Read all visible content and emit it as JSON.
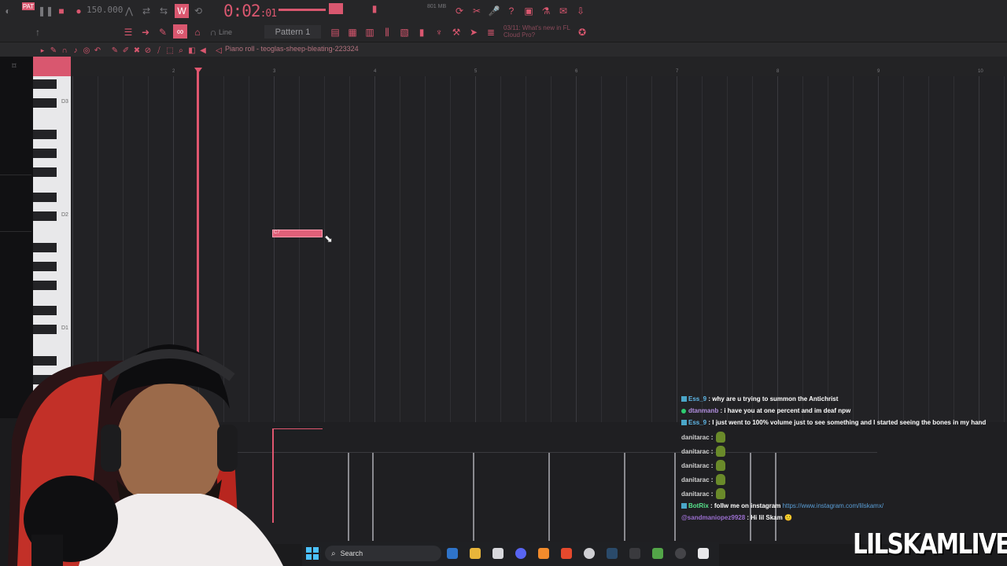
{
  "toolbar": {
    "tempo": "150.000",
    "time_main": "0:02",
    "time_sub": ":01",
    "ram": "801 MB",
    "news": "03/11: What's new in FL Cloud Pro?",
    "pattern": "Pattern 1",
    "snap_mode": "Line"
  },
  "piano_roll": {
    "title": "Piano roll - teoglas-sheep-bleating-223324",
    "key_labels": [
      "D3",
      "D2",
      "D1"
    ],
    "bar_numbers": [
      "2",
      "3",
      "4",
      "5",
      "6",
      "7",
      "8",
      "9",
      "10"
    ],
    "note_label": "C7"
  },
  "chat": [
    {
      "user": "Ess_9",
      "text": ": why are u trying to summon the Antichrist",
      "color": "#5fb8e8",
      "badge": "mod"
    },
    {
      "user": "dtanmanb",
      "text": ": i have you at one percent and im deaf npw",
      "color": "#b28fe0",
      "badge": "dot"
    },
    {
      "user": "Ess_9",
      "text": ": I just went to 100% volume just to see something and I started seeing the bones in my hand",
      "color": "#5fb8e8",
      "badge": "mod"
    },
    {
      "user": "danitarac",
      "text": ":",
      "color": "#d0d0d0",
      "badge": "none",
      "emote": "goblin"
    },
    {
      "user": "danitarac",
      "text": ":",
      "color": "#d0d0d0",
      "badge": "none",
      "emote": "goblin"
    },
    {
      "user": "danitarac",
      "text": ":",
      "color": "#d0d0d0",
      "badge": "none",
      "emote": "goblin"
    },
    {
      "user": "danitarac",
      "text": ":",
      "color": "#d0d0d0",
      "badge": "none",
      "emote": "goblin"
    },
    {
      "user": "danitarac",
      "text": ":",
      "color": "#d0d0d0",
      "badge": "none",
      "emote": "goblin"
    },
    {
      "user": "BotRix",
      "text": ": follw me on instagram ",
      "link": "https://www.instagram.com/lilskamx/",
      "color": "#57e38c",
      "badge": "mod"
    },
    {
      "user": "@sandmaniopez9928",
      "text": " : Hi lil Skam 🙂",
      "color": "#9b6fd0",
      "badge": "none"
    }
  ],
  "taskbar": {
    "search_label": "Search"
  },
  "brand": "LILSKAMLIVE",
  "colors": {
    "accent": "#d9576f",
    "background": "#1b1b1d",
    "grid": "#222225"
  }
}
